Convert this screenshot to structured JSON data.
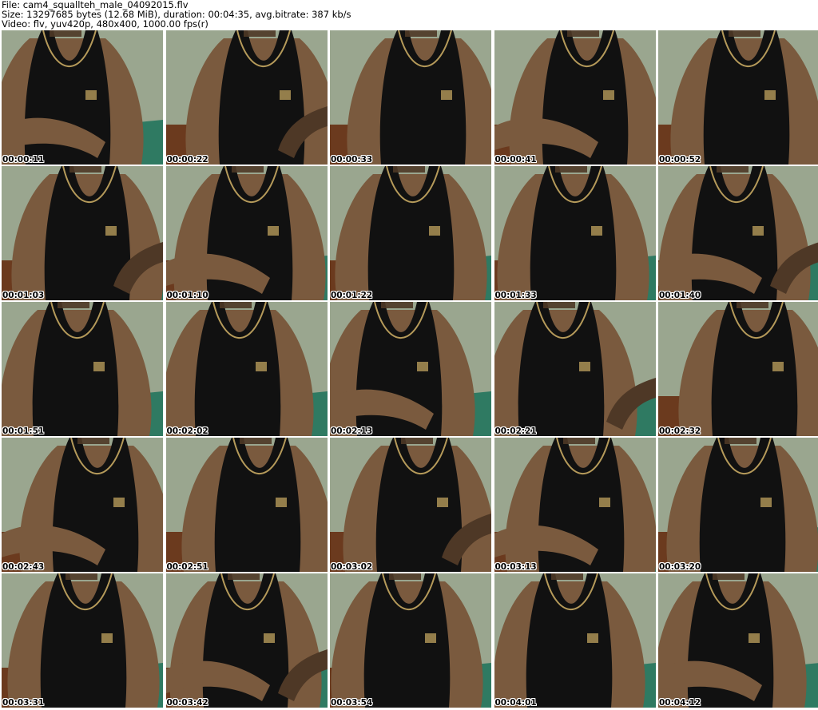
{
  "header": {
    "file_line": "File: cam4_squallteh_male_04092015.flv",
    "size_line": "Size: 13297685 bytes (12.68 MiB), duration: 00:04:35, avg.bitrate: 387 kb/s",
    "video_line": "Video: flv, yuv420p, 480x400, 1000.00 fps(r)"
  },
  "thumbnails": [
    {
      "timestamp": "00:00:11"
    },
    {
      "timestamp": "00:00:22"
    },
    {
      "timestamp": "00:00:33"
    },
    {
      "timestamp": "00:00:41"
    },
    {
      "timestamp": "00:00:52"
    },
    {
      "timestamp": "00:01:03"
    },
    {
      "timestamp": "00:01:10"
    },
    {
      "timestamp": "00:01:22"
    },
    {
      "timestamp": "00:01:33"
    },
    {
      "timestamp": "00:01:40"
    },
    {
      "timestamp": "00:01:51"
    },
    {
      "timestamp": "00:02:02"
    },
    {
      "timestamp": "00:02:13"
    },
    {
      "timestamp": "00:02:21"
    },
    {
      "timestamp": "00:02:32"
    },
    {
      "timestamp": "00:02:43"
    },
    {
      "timestamp": "00:02:51"
    },
    {
      "timestamp": "00:03:02"
    },
    {
      "timestamp": "00:03:13"
    },
    {
      "timestamp": "00:03:20"
    },
    {
      "timestamp": "00:03:31"
    },
    {
      "timestamp": "00:03:42"
    },
    {
      "timestamp": "00:03:54"
    },
    {
      "timestamp": "00:04:01"
    },
    {
      "timestamp": "00:04:12"
    }
  ],
  "colors": {
    "wall": "#9aa68f",
    "floor": "#6b3a1e",
    "mat": "#2f7a62",
    "tank_top": "#111111",
    "trim": "#b59a5a",
    "skin": "#7a5a3e",
    "skin_shadow": "#4e3826"
  }
}
